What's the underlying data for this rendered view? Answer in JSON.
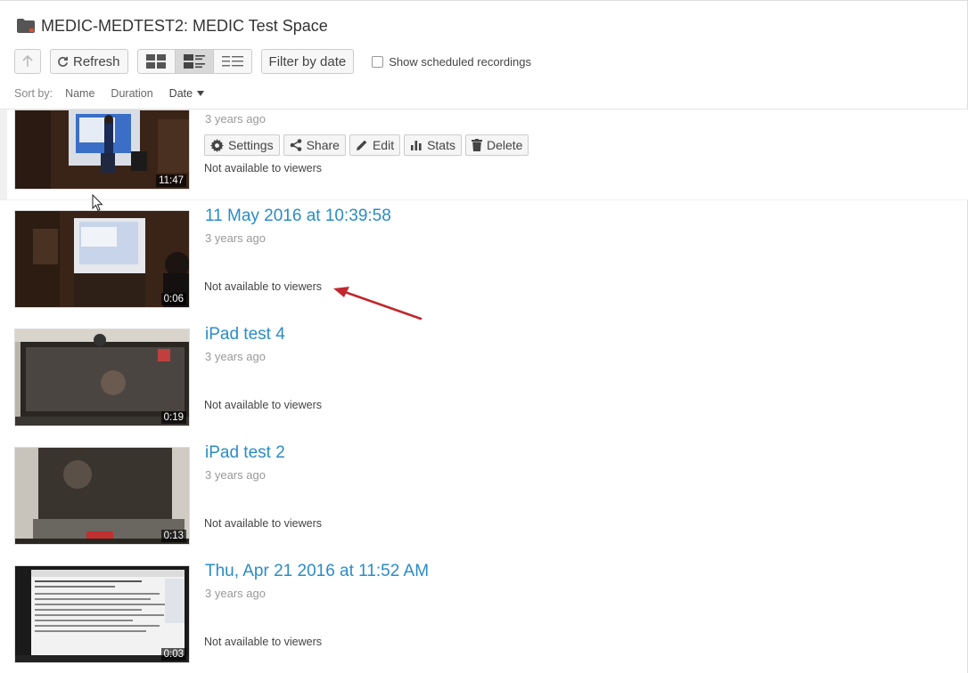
{
  "header": {
    "title": "MEDIC-MEDTEST2: MEDIC Test Space"
  },
  "toolbar": {
    "refresh_label": "Refresh",
    "filter_label": "Filter by date",
    "show_scheduled_label": "Show scheduled recordings",
    "show_scheduled_checked": false,
    "view_mode_selected": "list-detail"
  },
  "sort": {
    "label": "Sort by:",
    "options": [
      "Name",
      "Duration",
      "Date"
    ],
    "active": "Date"
  },
  "actions": {
    "settings": "Settings",
    "share": "Share",
    "edit": "Edit",
    "stats": "Stats",
    "delete": "Delete"
  },
  "recordings": [
    {
      "title": "",
      "age": "3 years ago",
      "availability": "Not available to viewers",
      "duration": "11:47"
    },
    {
      "title": "11 May 2016 at 10:39:58",
      "age": "3 years ago",
      "availability": "Not available to viewers",
      "duration": "0:06"
    },
    {
      "title": "iPad test 4",
      "age": "3 years ago",
      "availability": "Not available to viewers",
      "duration": "0:19"
    },
    {
      "title": "iPad test 2",
      "age": "3 years ago",
      "availability": "Not available to viewers",
      "duration": "0:13"
    },
    {
      "title": "Thu, Apr 21 2016 at 11:52 AM",
      "age": "3 years ago",
      "availability": "Not available to viewers",
      "duration": "0:03"
    }
  ],
  "colors": {
    "link": "#2a8cc7",
    "annotation_arrow": "#c0282d",
    "folder_accent": "#e24c2c"
  }
}
